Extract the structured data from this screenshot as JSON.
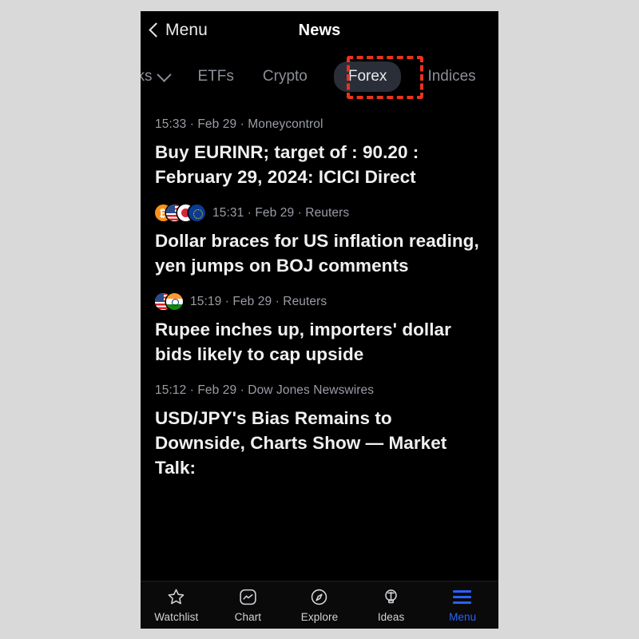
{
  "header": {
    "back_label": "Menu",
    "title": "News",
    "back_icon": "chevron-left-icon"
  },
  "tabs": [
    {
      "label": "cks",
      "icon": "chevron-down-icon",
      "active": false,
      "truncated": true
    },
    {
      "label": "ETFs",
      "active": false
    },
    {
      "label": "Crypto",
      "active": false
    },
    {
      "label": "Forex",
      "active": true
    },
    {
      "label": "Indices",
      "active": false
    }
  ],
  "news": [
    {
      "flags": [],
      "time": "15:33",
      "date": "Feb 29",
      "source": "Moneycontrol",
      "meta": "15:33 · Feb 29 · Moneycontrol",
      "headline": "Buy EURINR; target of : 90.20 : February 29, 2024: ICICI Direct"
    },
    {
      "flags": [
        "bitcoin-icon",
        "flag-us-icon",
        "flag-jp-icon",
        "flag-eu-icon"
      ],
      "time": "15:31",
      "date": "Feb 29",
      "source": "Reuters",
      "meta": "15:31 · Feb 29 · Reuters",
      "headline": "Dollar braces for US inflation reading, yen jumps on BOJ comments"
    },
    {
      "flags": [
        "flag-us-icon",
        "flag-in-icon"
      ],
      "time": "15:19",
      "date": "Feb 29",
      "source": "Reuters",
      "meta": "15:19 · Feb 29 · Reuters",
      "headline": "Rupee inches up, importers' dollar bids likely to cap upside"
    },
    {
      "flags": [],
      "time": "15:12",
      "date": "Feb 29",
      "source": "Dow Jones Newswires",
      "meta": "15:12 · Feb 29 · Dow Jones Newswires",
      "headline": "USD/JPY's Bias Remains to Downside, Charts Show — Market Talk:"
    }
  ],
  "bottom_nav": [
    {
      "label": "Watchlist",
      "icon": "star-icon",
      "active": false
    },
    {
      "label": "Chart",
      "icon": "chart-wave-icon",
      "active": false
    },
    {
      "label": "Explore",
      "icon": "compass-icon",
      "active": false
    },
    {
      "label": "Ideas",
      "icon": "lightbulb-icon",
      "active": false
    },
    {
      "label": "Menu",
      "icon": "hamburger-icon",
      "active": true
    }
  ],
  "colors": {
    "page_background": "#d9d9d9",
    "app_background": "#000000",
    "accent_blue": "#2962ff",
    "active_tab_pill": "#2a2e39",
    "muted_text": "#9a9da5",
    "annotation_red": "#e8341c"
  },
  "annotation": {
    "target": "Forex",
    "style": "red-dashed-rectangle"
  }
}
